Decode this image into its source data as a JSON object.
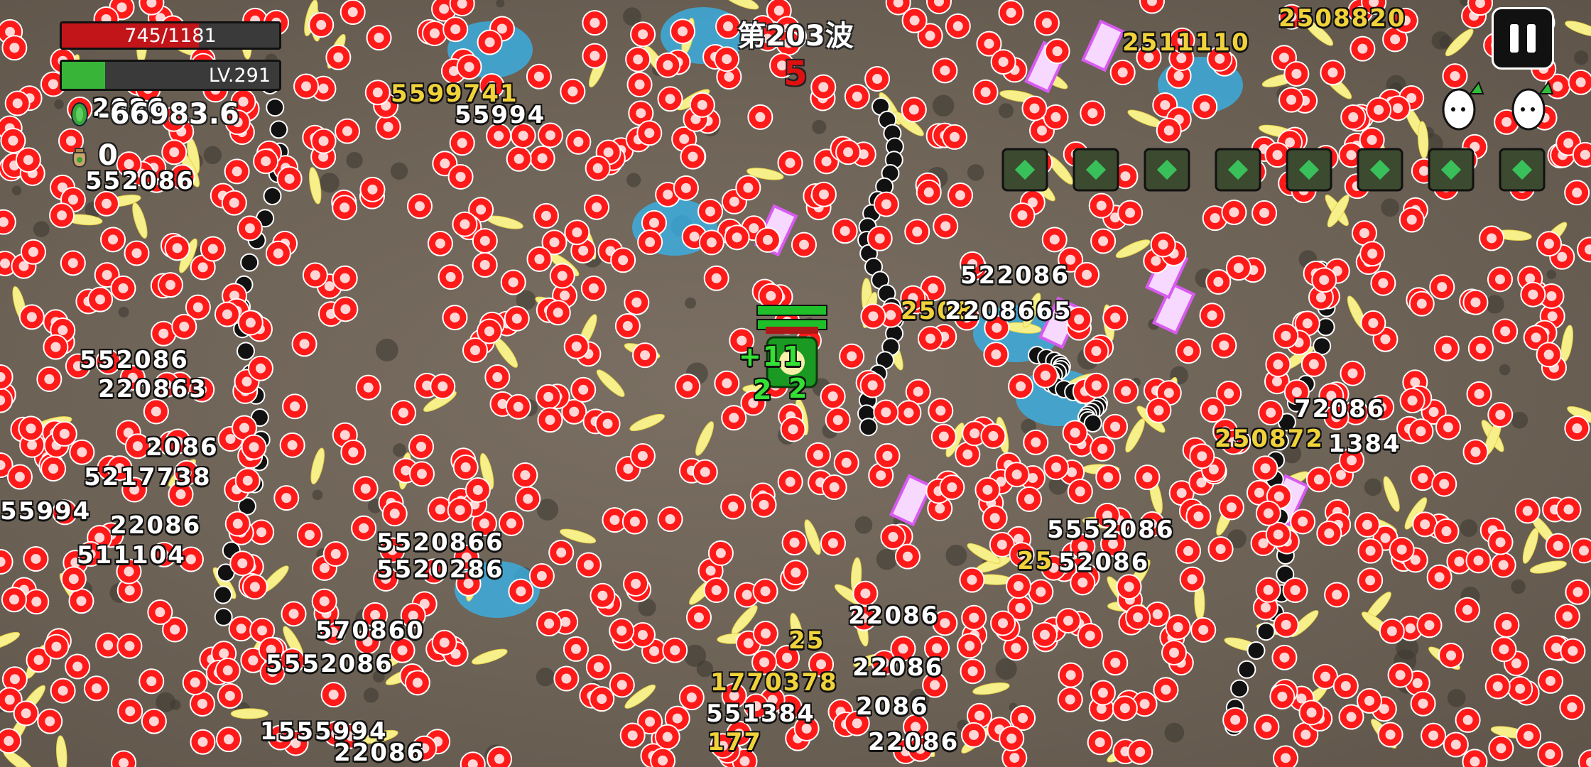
{
  "hud": {
    "hp_text": "745/1181",
    "hp_fraction": 0.631,
    "level_text": "LV.291",
    "xp_fraction": 0.2,
    "coins_value": "-66983.6",
    "bag_value": "0",
    "wave_title": "第203波",
    "wave_counter": "5",
    "pause_icon": "pause-icon",
    "hp_color": "#c2151a",
    "xp_color": "#38b538",
    "egg_icons": [
      "egg-upgrade-icon",
      "egg-upgrade-icon"
    ],
    "crate_icon": "supply-crate-icon"
  },
  "damage_numbers": [
    {
      "text": "5599741",
      "style": "gold"
    },
    {
      "text": "55994",
      "style": "white"
    },
    {
      "text": "2086",
      "style": "white"
    },
    {
      "text": "552086",
      "style": "white"
    },
    {
      "text": "552086",
      "style": "white"
    },
    {
      "text": "220863",
      "style": "white"
    },
    {
      "text": "2086",
      "style": "white"
    },
    {
      "text": "5217738",
      "style": "white"
    },
    {
      "text": "55994",
      "style": "white"
    },
    {
      "text": "22086",
      "style": "white"
    },
    {
      "text": "511104",
      "style": "white"
    },
    {
      "text": "5520866",
      "style": "white"
    },
    {
      "text": "5520286",
      "style": "white"
    },
    {
      "text": "570860",
      "style": "white"
    },
    {
      "text": "5552086",
      "style": "white"
    },
    {
      "text": "1555994",
      "style": "white"
    },
    {
      "text": "22086",
      "style": "white"
    },
    {
      "text": "2508820",
      "style": "gold"
    },
    {
      "text": "2511110",
      "style": "gold"
    },
    {
      "text": "522086",
      "style": "white"
    },
    {
      "text": "2508",
      "style": "gold"
    },
    {
      "text": "2208665",
      "style": "white"
    },
    {
      "text": "72086",
      "style": "white"
    },
    {
      "text": "250872",
      "style": "gold"
    },
    {
      "text": "1384",
      "style": "white"
    },
    {
      "text": "5552086",
      "style": "white"
    },
    {
      "text": "25",
      "style": "gold"
    },
    {
      "text": "52086",
      "style": "white"
    },
    {
      "text": "22086",
      "style": "white"
    },
    {
      "text": "25",
      "style": "gold"
    },
    {
      "text": "1770378",
      "style": "gold"
    },
    {
      "text": "551384",
      "style": "white"
    },
    {
      "text": "177",
      "style": "gold"
    },
    {
      "text": "22086",
      "style": "white"
    },
    {
      "text": "2086",
      "style": "white"
    },
    {
      "text": "22086",
      "style": "white"
    },
    {
      "text": "+11",
      "style": "green"
    },
    {
      "text": "2",
      "style": "green"
    },
    {
      "text": "2",
      "style": "green"
    }
  ]
}
